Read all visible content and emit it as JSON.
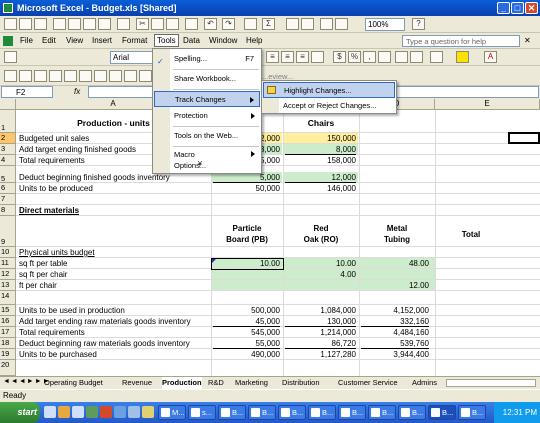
{
  "window": {
    "title": "Microsoft Excel - Budget.xls  [Shared]"
  },
  "menubar": {
    "items": [
      "File",
      "Edit",
      "View",
      "Insert",
      "Format",
      "Tools",
      "Data",
      "Window",
      "Help"
    ],
    "help_placeholder": "Type a question for help"
  },
  "toolbar": {
    "zoom": "100%",
    "font": "Arial",
    "review_label": "...eview..."
  },
  "formula_bar": {
    "name_box": "F2",
    "fx": "fx",
    "value": ""
  },
  "tools_menu": {
    "items": [
      {
        "label": "Spelling...",
        "shortcut": "F7"
      },
      {
        "label": "Share Workbook..."
      },
      {
        "label": "Track Changes"
      },
      {
        "label": "Protection"
      },
      {
        "label": "Tools on the Web..."
      },
      {
        "label": "Macro"
      },
      {
        "label": "Options..."
      }
    ],
    "more": "¥"
  },
  "track_submenu": {
    "items": [
      "Highlight Changes...",
      "Accept or Reject Changes..."
    ]
  },
  "grid": {
    "columns": [
      "A",
      "B",
      "C",
      "D",
      "E"
    ],
    "rows": [
      "1",
      "2",
      "3",
      "4",
      "5",
      "6",
      "7",
      "8",
      "9",
      "10",
      "11",
      "12",
      "13",
      "14",
      "15",
      "16",
      "17",
      "18",
      "19",
      "20"
    ],
    "r1": {
      "a": "Production - units",
      "c": "Chairs"
    },
    "r2": {
      "a": "Budgeted unit sales",
      "b": "2,000",
      "c": "150,000"
    },
    "r3": {
      "a": "Add target ending finished goods",
      "b": "3,000",
      "c": "8,000"
    },
    "r4": {
      "a": "Total requirements",
      "b": "5,000",
      "c": "158,000"
    },
    "r5": {
      "a": "Deduct beginning finished goods inventory",
      "b": "5,000",
      "c": "12,000"
    },
    "r6": {
      "a": "Units to be produced",
      "b": "50,000",
      "c": "146,000"
    },
    "r8": {
      "a": "Direct materials"
    },
    "r9": {
      "b1": "Particle",
      "b2": "Board (PB)",
      "c1": "Red",
      "c2": "Oak (RO)",
      "d1": "Metal",
      "d2": "Tubing",
      "e": "Total"
    },
    "r10": {
      "a": "Physical units budget"
    },
    "r11": {
      "a": "sq ft per table",
      "b": "10.00",
      "c": "10.00",
      "d": "48.00"
    },
    "r12": {
      "a": "sq ft per chair",
      "c": "4.00"
    },
    "r13": {
      "a": "ft per chair",
      "d": "12.00"
    },
    "r15": {
      "a": "Units to be used in production",
      "b": "500,000",
      "c": "1,084,000",
      "d": "4,152,000"
    },
    "r16": {
      "a": "Add target ending raw materials goods inventory",
      "b": "45,000",
      "c": "130,000",
      "d": "332,160"
    },
    "r17": {
      "a": "Total requirements",
      "b": "545,000",
      "c": "1,214,000",
      "d": "4,484,160"
    },
    "r18": {
      "a": "Deduct beginning raw materials goods inventory",
      "b": "55,000",
      "c": "86,720",
      "d": "539,760"
    },
    "r19": {
      "a": "Units to be purchased",
      "b": "490,000",
      "c": "1,127,280",
      "d": "3,944,400"
    }
  },
  "sheet_tabs": [
    "Operating Budget",
    "Revenue",
    "Production",
    "R&D",
    "Marketing",
    "Distribution",
    "Customer Service",
    "Admins"
  ],
  "active_tab": "Production",
  "status": "Ready",
  "taskbar": {
    "start": "start",
    "items": [
      "M...",
      "s...",
      "B...",
      "B...",
      "B...",
      "B...",
      "B...",
      "B...",
      "B...",
      "B...",
      "B..."
    ],
    "clock": "12:31 PM"
  }
}
